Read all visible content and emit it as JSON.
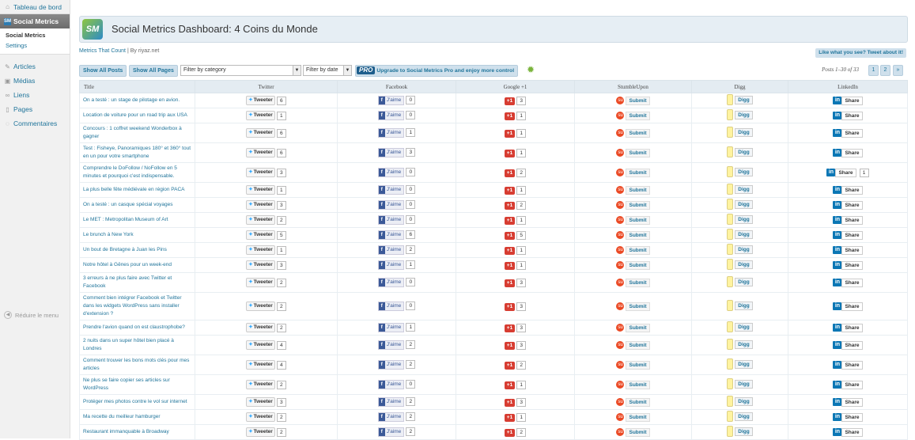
{
  "sidebar": {
    "dashboard": "Tableau de bord",
    "social_metrics": "Social Metrics",
    "submenu": [
      "Social Metrics",
      "Settings"
    ],
    "items": [
      "Articles",
      "Médias",
      "Liens",
      "Pages",
      "Commentaires"
    ],
    "collapse": "Réduire le menu"
  },
  "header": {
    "logo": "SM",
    "title": "Social Metrics Dashboard: 4 Coins du Monde",
    "tagline_link": "Metrics That Count",
    "tagline_rest": " | By riyaz.net",
    "tweet_about": "Like what you see? Tweet about it!"
  },
  "toolbar": {
    "show_all_posts": "Show All Posts",
    "show_all_pages": "Show All Pages",
    "category_filter": "Filter by category",
    "date_filter": "Filter by date",
    "pro_badge": "PRO",
    "upgrade": "Upgrade to Social Metrics Pro and enjoy more control",
    "posts_count": "Posts 1–30 of 33",
    "pages": [
      "1",
      "2",
      "»"
    ]
  },
  "table": {
    "columns": [
      "Title",
      "Twitter",
      "Facebook",
      "Google +1",
      "StumbleUpon",
      "Digg",
      "LinkedIn"
    ],
    "tweet_label": "Tweeter",
    "like_label": "J'aime",
    "plus_label": "+1",
    "submit_label": "Submit",
    "digg_label": "Digg",
    "share_label": "Share",
    "rows": [
      {
        "title": "On a testé : un stage de pilotage en avion.",
        "tw": "6",
        "fb": "0",
        "gp": "3",
        "li": ""
      },
      {
        "title": "Location de voiture pour un road trip aux USA",
        "tw": "1",
        "fb": "0",
        "gp": "1",
        "li": ""
      },
      {
        "title": "Concours : 1 coffret weekend Wonderbox à gagner",
        "tw": "6",
        "fb": "1",
        "gp": "1",
        "li": ""
      },
      {
        "title": "Test : Fisheye, Panoramiques 180° et 360° tout en un pour votre smartphone",
        "tw": "6",
        "fb": "3",
        "gp": "1",
        "li": ""
      },
      {
        "title": "Comprendre le DoFollow / NoFollow en 5 minutes et pourquoi c'est indispensable.",
        "tw": "3",
        "fb": "0",
        "gp": "2",
        "li": "1"
      },
      {
        "title": "La plus belle fête médiévale en région PACA",
        "tw": "1",
        "fb": "0",
        "gp": "1",
        "li": ""
      },
      {
        "title": "On a testé : un casque spécial voyages",
        "tw": "3",
        "fb": "0",
        "gp": "2",
        "li": ""
      },
      {
        "title": "Le MET : Metropolitan Museum of Art",
        "tw": "2",
        "fb": "0",
        "gp": "1",
        "li": ""
      },
      {
        "title": "Le brunch à New York",
        "tw": "5",
        "fb": "6",
        "gp": "5",
        "li": ""
      },
      {
        "title": "Un bout de Bretagne à Juan les Pins",
        "tw": "1",
        "fb": "2",
        "gp": "1",
        "li": ""
      },
      {
        "title": "Notre hôtel à Gênes pour un week-end",
        "tw": "3",
        "fb": "1",
        "gp": "1",
        "li": ""
      },
      {
        "title": "3 erreurs à ne plus faire avec Twitter et Facebook",
        "tw": "2",
        "fb": "0",
        "gp": "3",
        "li": ""
      },
      {
        "title": "Comment bien intégrer Facebook et Twitter dans les widgets WordPress sans installer d'extension ?",
        "tw": "2",
        "fb": "0",
        "gp": "3",
        "li": ""
      },
      {
        "title": "Prendre l'avion quand on est claustrophobe?",
        "tw": "2",
        "fb": "1",
        "gp": "3",
        "li": ""
      },
      {
        "title": "2 nuits dans un super hôtel bien placé à Londres",
        "tw": "4",
        "fb": "2",
        "gp": "3",
        "li": ""
      },
      {
        "title": "Comment trouver les bons mots clés pour mes articles",
        "tw": "4",
        "fb": "2",
        "gp": "2",
        "li": ""
      },
      {
        "title": "Ne plus se faire copier ses articles sur WordPress",
        "tw": "2",
        "fb": "0",
        "gp": "1",
        "li": ""
      },
      {
        "title": "Protéger mes photos contre le vol sur internet",
        "tw": "3",
        "fb": "2",
        "gp": "3",
        "li": ""
      },
      {
        "title": "Ma recette du meilleur hamburger",
        "tw": "2",
        "fb": "2",
        "gp": "1",
        "li": ""
      },
      {
        "title": "Restaurant immanquable à Broadway",
        "tw": "2",
        "fb": "2",
        "gp": "2",
        "li": ""
      }
    ]
  },
  "colors": {
    "accent": "#21759b",
    "header_bg": "#e6eef4",
    "gplus": "#d73d32",
    "facebook": "#3b5998",
    "linkedin": "#0b77b5",
    "stumble": "#eb4924"
  }
}
